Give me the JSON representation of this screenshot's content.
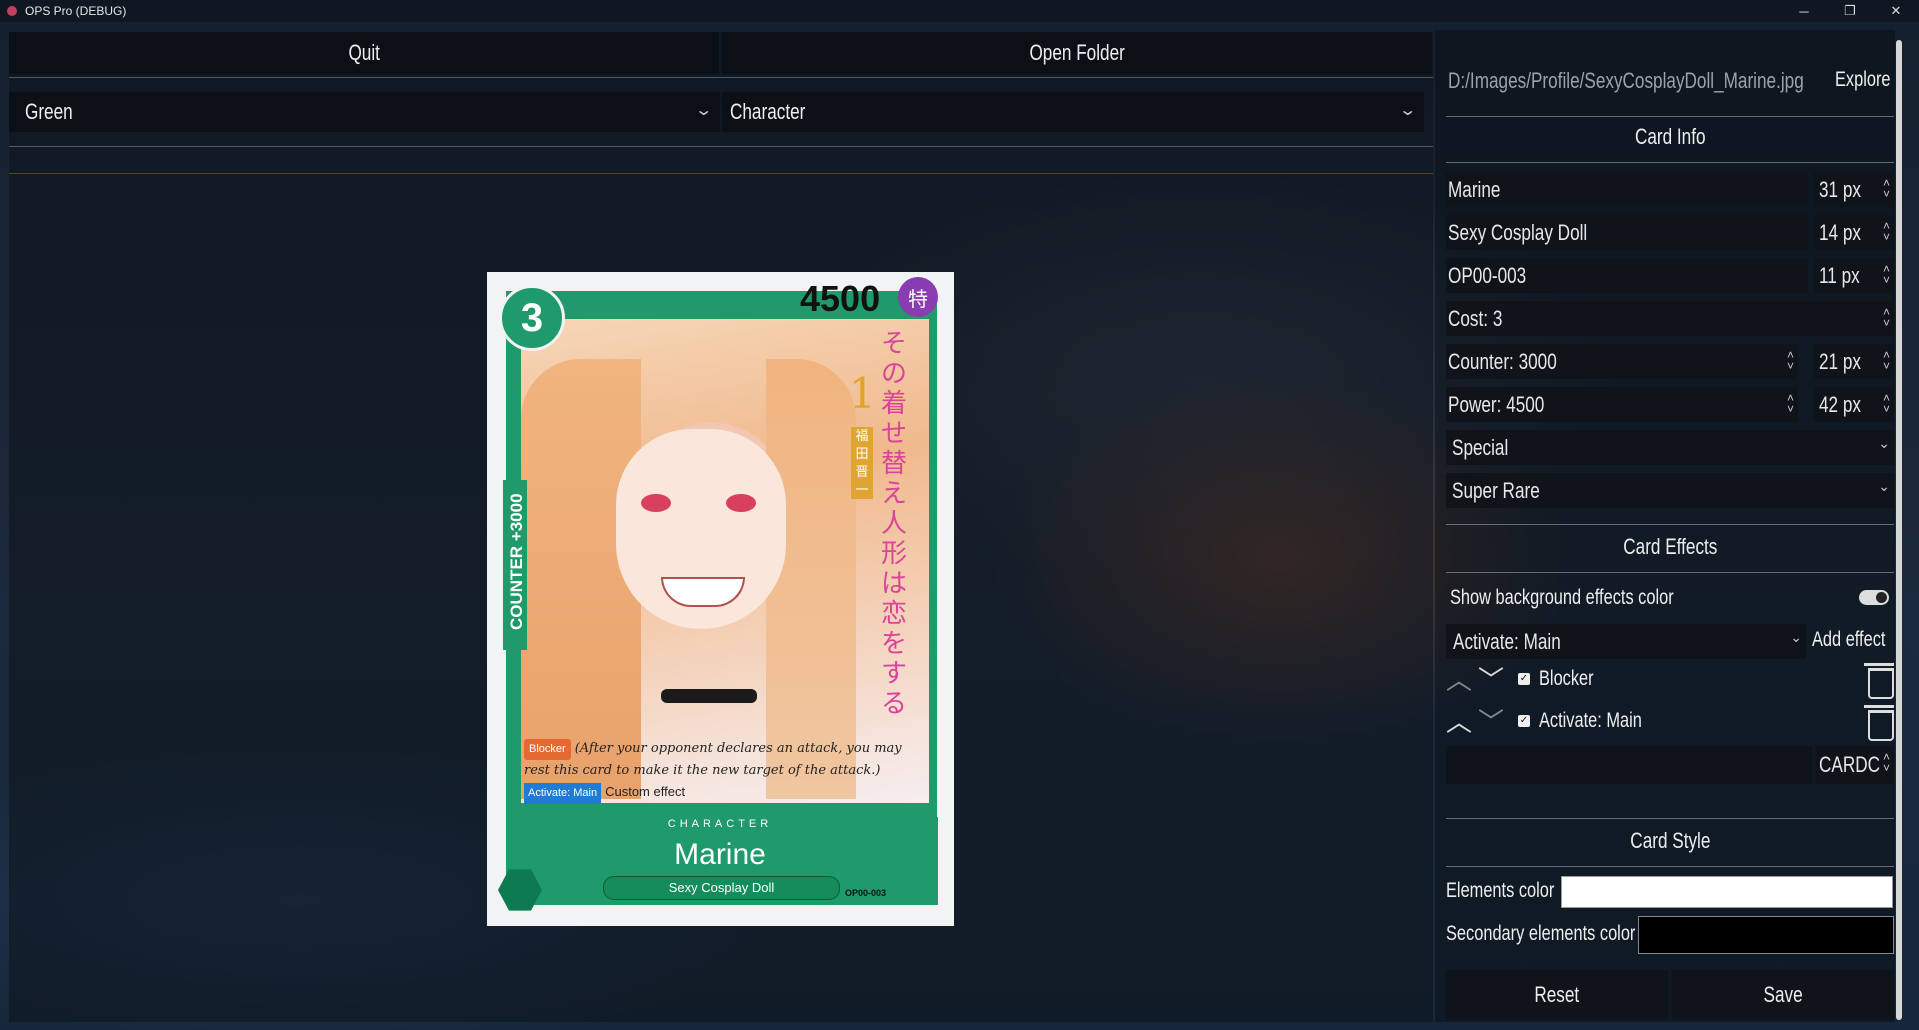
{
  "window": {
    "title": "OPS Pro (DEBUG)",
    "minimize": "─",
    "restore": "❐",
    "close": "✕"
  },
  "top": {
    "quit_label": "Quit",
    "open_folder_label": "Open Folder"
  },
  "filters": {
    "color_value": "Green",
    "type_value": "Character"
  },
  "card_preview": {
    "cost": "3",
    "power": "4500",
    "special_badge": "特",
    "counter_text": "COUNTER +3000",
    "art_title_jp": "その着せ替え人形は恋をする",
    "art_volume": "1",
    "art_author_jp": "福田晋一",
    "effect_tag_blocker": "Blocker",
    "effect_text_blocker": "(After your opponent declares an attack, you may rest this card to make it the new target of the attack.)",
    "effect_tag_main": "Activate: Main",
    "effect_text_main": "Custom effect",
    "type_label": "CHARACTER",
    "name": "Marine",
    "subtitle": "Sexy Cosplay Doll",
    "card_id": "OP00-003"
  },
  "right_panel": {
    "image_path": "D:/Images/Profile/SexyCosplayDoll_Marine.jpg",
    "explore_label": "Explore",
    "card_info_heading": "Card Info",
    "name_field": "Marine",
    "name_size": "31 px",
    "subtitle_field": "Sexy Cosplay Doll",
    "subtitle_size": "14 px",
    "id_field": "OP00-003",
    "id_size": "11 px",
    "cost_field": "Cost: 3",
    "counter_field": "Counter: 3000",
    "counter_size": "21 px",
    "power_field": "Power: 4500",
    "power_size": "42 px",
    "rarity_select": "Special",
    "rarity2_select": "Super Rare",
    "card_effects_heading": "Card Effects",
    "show_bg_label": "Show background effects color",
    "show_bg_on": true,
    "effect_type_select": "Activate: Main",
    "add_effect_label": "Add effect",
    "effects": [
      {
        "label": "Blocker",
        "checked": true
      },
      {
        "label": "Activate: Main",
        "checked": true
      }
    ],
    "effect_text_value": "",
    "font_select": "CARDC",
    "card_style_heading": "Card Style",
    "elements_color_label": "Elements color",
    "elements_color": "#ffffff",
    "secondary_color_label": "Secondary elements color",
    "secondary_color": "#000000",
    "reset_label": "Reset",
    "save_label": "Save"
  },
  "accent_color": "#1f9a6a"
}
